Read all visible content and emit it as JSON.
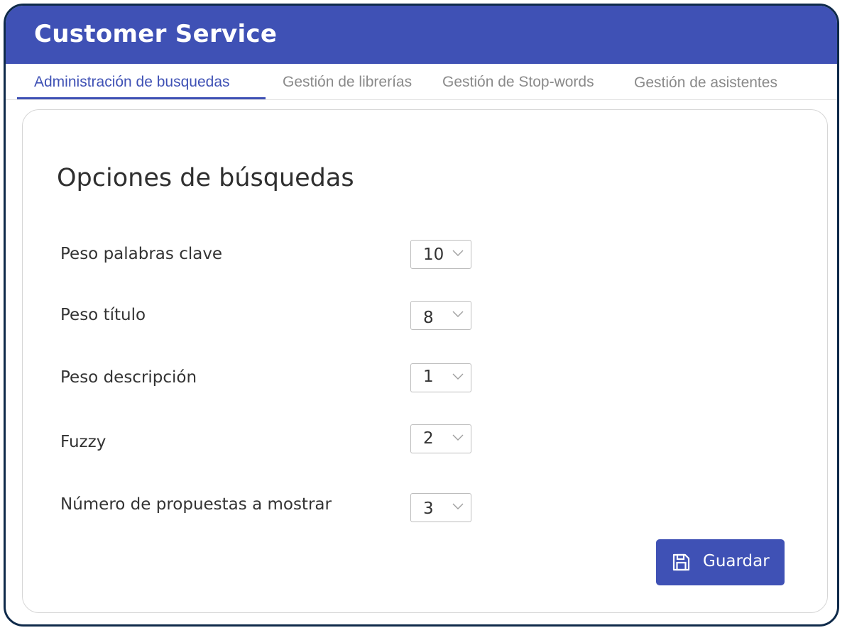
{
  "header": {
    "title": "Customer Service"
  },
  "tabs": [
    {
      "label": "Administración de busquedas",
      "active": true
    },
    {
      "label": "Gestión de librerías",
      "active": false
    },
    {
      "label": "Gestión de Stop-words",
      "active": false
    },
    {
      "label": "Gestión de asistentes",
      "active": false
    }
  ],
  "section": {
    "title": "Opciones de búsquedas",
    "options": [
      {
        "label": "Peso palabras clave",
        "value": "10"
      },
      {
        "label": "Peso título",
        "value": "8"
      },
      {
        "label": "Peso descripción",
        "value": "1"
      },
      {
        "label": "Fuzzy",
        "value": "2"
      },
      {
        "label": "Número de propuestas a mostrar",
        "value": "3"
      }
    ]
  },
  "actions": {
    "save_label": "Guardar",
    "save_icon": "save-icon"
  },
  "colors": {
    "primary": "#3f51b5",
    "frame_border": "#0f2a4a",
    "tab_inactive": "#8a8a8a"
  },
  "icons": {
    "dropdown": "chevron-down-icon",
    "save": "floppy-disk-icon"
  }
}
